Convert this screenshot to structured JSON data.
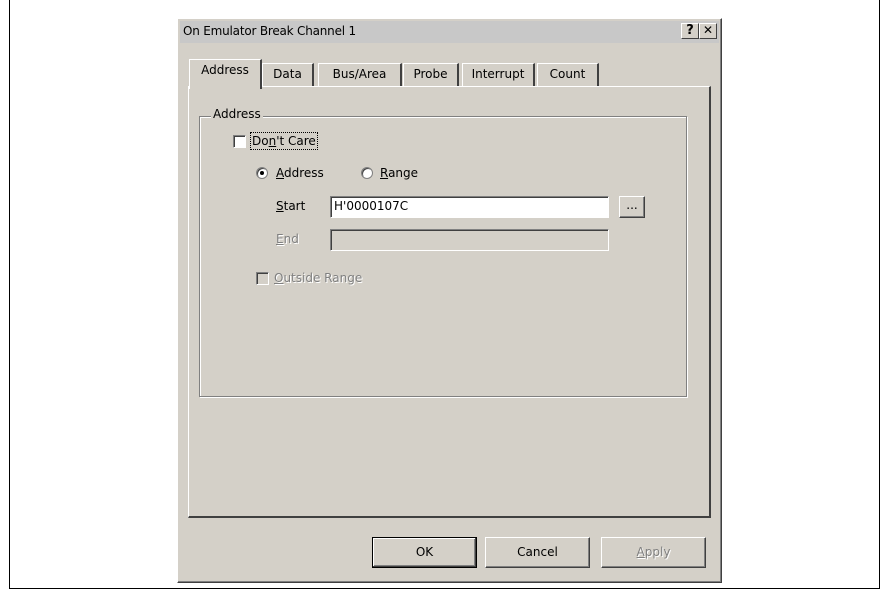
{
  "window": {
    "title": "On Emulator Break Channel 1",
    "help_glyph": "?",
    "close_glyph": "✕"
  },
  "tabs": [
    {
      "label": "Address",
      "active": true
    },
    {
      "label": "Data"
    },
    {
      "label": "Bus/Area"
    },
    {
      "label": "Probe"
    },
    {
      "label": "Interrupt"
    },
    {
      "label": "Count"
    }
  ],
  "address_group": {
    "legend": "Address",
    "dont_care": {
      "label_pre": "Do",
      "label_u": "n",
      "label_post": "'t Care",
      "checked": false
    },
    "radio_address": {
      "label_pre": "",
      "label_u": "A",
      "label_post": "ddress",
      "selected": true
    },
    "radio_range": {
      "label_pre": "",
      "label_u": "R",
      "label_post": "ange",
      "selected": false
    },
    "start": {
      "label_u": "S",
      "label_post": "tart",
      "value": "H'0000107C"
    },
    "browse_label": "...",
    "end": {
      "label_u": "E",
      "label_post": "nd",
      "value": ""
    },
    "outside_range": {
      "label_u": "O",
      "label_post": "utside Range",
      "checked": false
    }
  },
  "buttons": {
    "ok": "OK",
    "cancel": "Cancel",
    "apply_u": "A",
    "apply_post": "pply"
  }
}
